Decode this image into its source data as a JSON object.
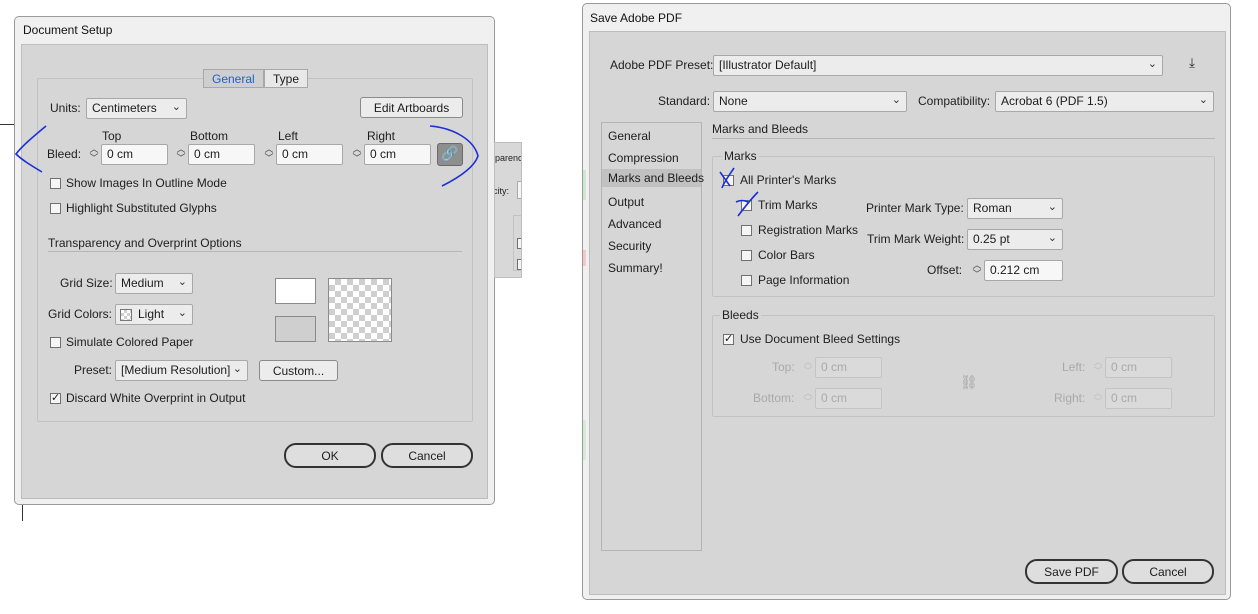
{
  "document_setup": {
    "title": "Document Setup",
    "tabs": [
      {
        "label": "General"
      },
      {
        "label": "Type"
      }
    ],
    "units_label": "Units:",
    "units_value": "Centimeters",
    "edit_artboards_label": "Edit Artboards",
    "bleed": {
      "label": "Bleed:",
      "top_label": "Top",
      "top_value": "0 cm",
      "bottom_label": "Bottom",
      "bottom_value": "0 cm",
      "left_label": "Left",
      "left_value": "0 cm",
      "right_label": "Right",
      "right_value": "0 cm"
    },
    "show_images_outline": {
      "label": "Show Images In Outline Mode",
      "checked": false
    },
    "highlight_glyphs": {
      "label": "Highlight Substituted Glyphs",
      "checked": false
    },
    "transparency_header": "Transparency and Overprint Options",
    "grid_size_label": "Grid Size:",
    "grid_size_value": "Medium",
    "grid_colors_label": "Grid Colors:",
    "grid_colors_value": "Light",
    "simulate_paper": {
      "label": "Simulate Colored Paper",
      "checked": false
    },
    "preset_label": "Preset:",
    "preset_value": "[Medium Resolution]",
    "custom_label": "Custom...",
    "discard_white": {
      "label": "Discard White Overprint in Output",
      "checked": true
    },
    "ok_label": "OK",
    "cancel_label": "Cancel"
  },
  "background_panel": {
    "label_1": "parenc",
    "label_2": "city:"
  },
  "save_pdf": {
    "title": "Save Adobe PDF",
    "preset_label": "Adobe PDF Preset:",
    "preset_value": "[Illustrator Default]",
    "standard_label": "Standard:",
    "standard_value": "None",
    "compat_label": "Compatibility:",
    "compat_value": "Acrobat 6 (PDF 1.5)",
    "nav": [
      {
        "label": "General"
      },
      {
        "label": "Compression"
      },
      {
        "label": "Marks and Bleeds"
      },
      {
        "label": "Output"
      },
      {
        "label": "Advanced"
      },
      {
        "label": "Security"
      },
      {
        "label": "Summary!"
      }
    ],
    "section_title": "Marks and Bleeds",
    "marks_header": "Marks",
    "marks": [
      {
        "label": "All Printer's Marks",
        "checked": false
      },
      {
        "label": "Trim Marks",
        "checked": false
      },
      {
        "label": "Registration Marks",
        "checked": false
      },
      {
        "label": "Color Bars",
        "checked": false
      },
      {
        "label": "Page Information",
        "checked": false
      }
    ],
    "mark_type_label": "Printer Mark Type:",
    "mark_type_value": "Roman",
    "trim_weight_label": "Trim Mark Weight:",
    "trim_weight_value": "0.25 pt",
    "offset_label": "Offset:",
    "offset_value": "0.212 cm",
    "bleeds_header": "Bleeds",
    "use_doc_bleed": {
      "label": "Use Document Bleed Settings",
      "checked": true
    },
    "top_label": "Top:",
    "top_value": "0 cm",
    "bottom_label": "Bottom:",
    "bottom_value": "0 cm",
    "left_label": "Left:",
    "left_value": "0 cm",
    "right_label": "Right:",
    "right_value": "0 cm",
    "save_label": "Save PDF",
    "cancel_label": "Cancel"
  },
  "colors": {
    "panel": "#d6d6d6",
    "active_tab_text": "#1a63c7",
    "ink": "#1a2fd6"
  }
}
